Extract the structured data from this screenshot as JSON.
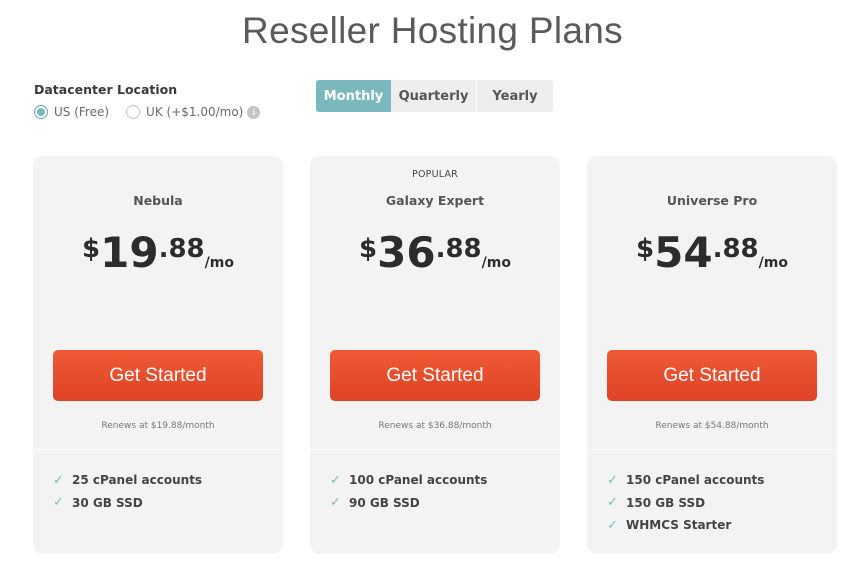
{
  "page": {
    "title": "Reseller Hosting Plans"
  },
  "datacenter": {
    "label": "Datacenter Location",
    "options": [
      {
        "label": "US (Free)",
        "selected": true
      },
      {
        "label": "UK (+$1.00/mo)",
        "selected": false
      }
    ],
    "info_icon": "i"
  },
  "billing": {
    "tabs": [
      {
        "label": "Monthly",
        "active": true
      },
      {
        "label": "Quarterly",
        "active": false
      },
      {
        "label": "Yearly",
        "active": false
      }
    ]
  },
  "colors": {
    "accent_teal": "#7ab8be",
    "cta_orange": "#e84e2e",
    "card_bg": "#f3f3f3"
  },
  "plans": [
    {
      "badge": "",
      "name": "Nebula",
      "price": {
        "currency": "$",
        "whole": "19",
        "cents": ".88",
        "per": "/mo"
      },
      "cta": "Get Started",
      "renews": "Renews at $19.88/month",
      "features": [
        "25 cPanel accounts",
        "30 GB SSD"
      ]
    },
    {
      "badge": "POPULAR",
      "name": "Galaxy Expert",
      "price": {
        "currency": "$",
        "whole": "36",
        "cents": ".88",
        "per": "/mo"
      },
      "cta": "Get Started",
      "renews": "Renews at $36.88/month",
      "features": [
        "100 cPanel accounts",
        "90 GB SSD"
      ]
    },
    {
      "badge": "",
      "name": "Universe Pro",
      "price": {
        "currency": "$",
        "whole": "54",
        "cents": ".88",
        "per": "/mo"
      },
      "cta": "Get Started",
      "renews": "Renews at $54.88/month",
      "features": [
        "150 cPanel accounts",
        "150 GB SSD",
        "WHMCS Starter"
      ]
    }
  ],
  "icons": {
    "check": "check-icon",
    "info": "info-icon"
  }
}
